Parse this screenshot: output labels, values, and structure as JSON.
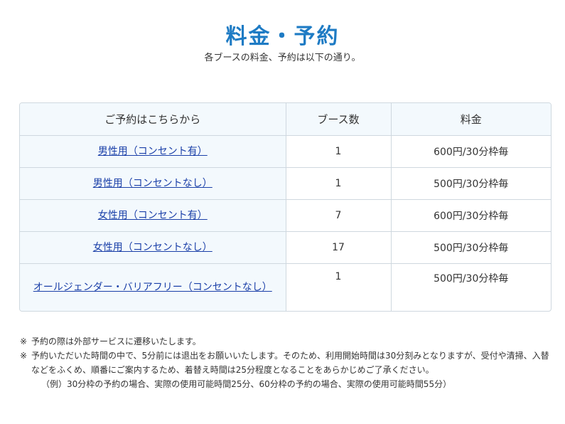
{
  "header": {
    "title": "料金・予約",
    "subtitle": "各ブースの料金、予約は以下の通り。"
  },
  "table": {
    "headers": [
      "ご予約はこちらから",
      "ブース数",
      "料金"
    ],
    "rows": [
      {
        "label": "男性用（コンセント有）",
        "count": "1",
        "price": "600円/30分枠毎"
      },
      {
        "label": "男性用（コンセントなし）",
        "count": "1",
        "price": "500円/30分枠毎"
      },
      {
        "label": "女性用（コンセント有）",
        "count": "7",
        "price": "600円/30分枠毎"
      },
      {
        "label": "女性用（コンセントなし）",
        "count": "17",
        "price": "500円/30分枠毎"
      },
      {
        "label": "オールジェンダー・バリアフリー（コンセントなし）",
        "count": "1",
        "price": "500円/30分枠毎"
      }
    ]
  },
  "notes": {
    "mark": "※",
    "items": [
      "予約の際は外部サービスに遷移いたします。",
      "予約いただいた時間の中で、5分前には退出をお願いいたします。そのため、利用開始時間は30分刻みとなりますが、受付や清掃、入替などをふくめ、順番にご案内するため、着替え時間は25分程度となることをあらかじめご了承ください。"
    ],
    "example": "（例）30分枠の予約の場合、実際の使用可能時間25分、60分枠の予約の場合、実際の使用可能時間55分）"
  }
}
